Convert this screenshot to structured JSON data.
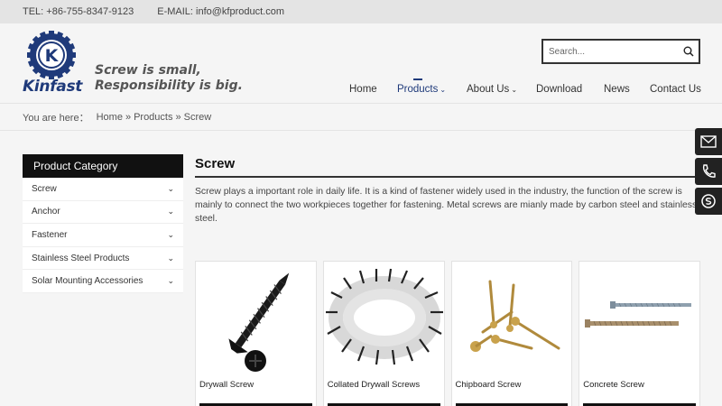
{
  "topbar": {
    "tel": "TEL: +86-755-8347-9123",
    "email": "E-MAIL: info@kfproduct.com"
  },
  "header": {
    "logo_text": "Kinfast",
    "logo_letter": "K",
    "slogan_line1": "Screw is small,",
    "slogan_line2": "Responsibility is big."
  },
  "search": {
    "placeholder": "Search..."
  },
  "nav": [
    {
      "label": "Home"
    },
    {
      "label": "Products"
    },
    {
      "label": "About Us"
    },
    {
      "label": "Download"
    },
    {
      "label": "News"
    },
    {
      "label": "Contact Us"
    }
  ],
  "breadcrumb": {
    "prefix": "You are here：",
    "home": "Home",
    "sep": "»",
    "products": "Products",
    "current": "Screw"
  },
  "sidebar": {
    "title": "Product Category",
    "items": [
      {
        "label": "Screw"
      },
      {
        "label": "Anchor"
      },
      {
        "label": "Fastener"
      },
      {
        "label": "Stainless Steel Products"
      },
      {
        "label": "Solar Mounting Accessories"
      }
    ]
  },
  "main": {
    "title": "Screw",
    "description": "Screw plays a important role in daily life. It is a kind of fastener widely used in the industry, the function of the screw is mainly to connect the two workpieces together for fastening. Metal screws are mianly made by carbon steel and stainless steel."
  },
  "products": [
    {
      "name": "Drywall Screw"
    },
    {
      "name": "Collated Drywall Screws"
    },
    {
      "name": "Chipboard Screw"
    },
    {
      "name": "Concrete Screw"
    }
  ],
  "side_buttons": [
    {
      "icon": "mail-icon"
    },
    {
      "icon": "phone-icon"
    },
    {
      "icon": "skype-icon"
    }
  ],
  "colors": {
    "brand_blue": "#1f3a7a",
    "sidebar_title_bg": "#111111"
  }
}
